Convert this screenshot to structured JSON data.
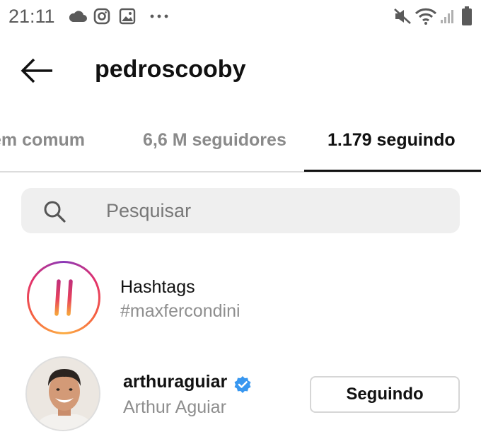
{
  "status_bar": {
    "time": "21:11",
    "left_icons": [
      "cloud-icon",
      "instagram-icon",
      "image-icon",
      "more-dots-icon"
    ],
    "right_icons": [
      "mute-icon",
      "wifi-icon",
      "signal-icon",
      "battery-icon"
    ]
  },
  "header": {
    "title": "pedroscooby",
    "back_icon": "arrow-left-icon"
  },
  "tabs": [
    {
      "label": "em comum",
      "active": false
    },
    {
      "label": "6,6 M seguidores",
      "active": false
    },
    {
      "label": "1.179 seguindo",
      "active": true
    }
  ],
  "search": {
    "placeholder": "Pesquisar",
    "value": "",
    "icon": "search-icon"
  },
  "hashtags_row": {
    "title": "Hashtags",
    "subtitle": "#maxfercondini",
    "icon": "hashtag-icon"
  },
  "users": [
    {
      "username": "arthuraguiar",
      "full_name": "Arthur Aguiar",
      "verified": true,
      "button_label": "Seguindo"
    }
  ],
  "colors": {
    "verified_blue": "#3897f0",
    "tab_active": "#111111",
    "tab_inactive": "#8a8a8a"
  }
}
